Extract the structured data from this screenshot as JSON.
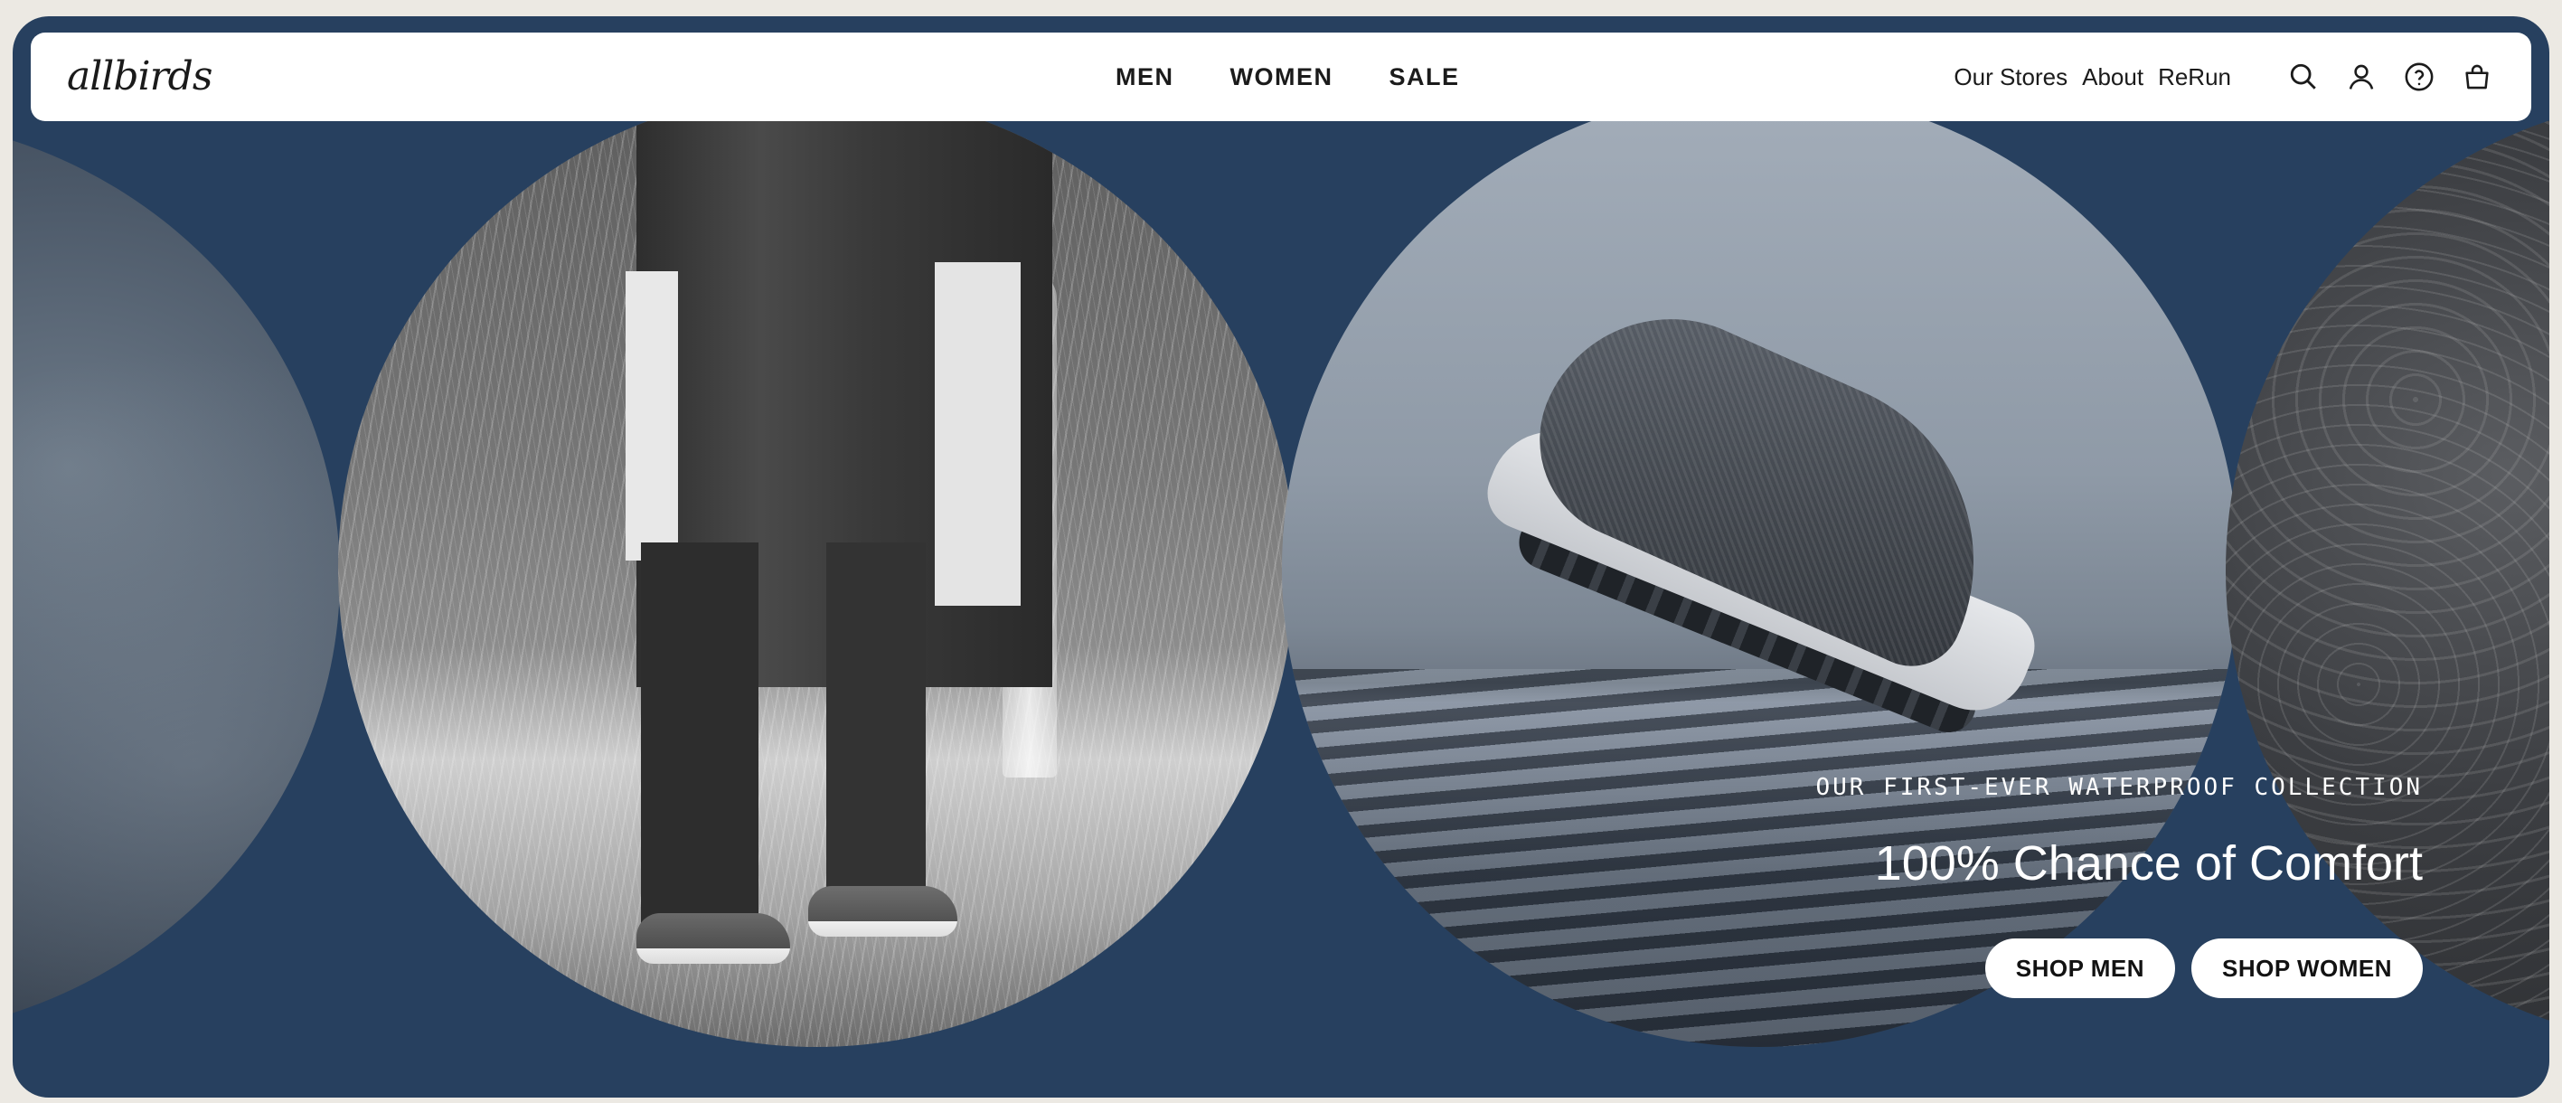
{
  "brand": {
    "logo_text": "allbirds"
  },
  "nav": {
    "primary": [
      {
        "label": "MEN"
      },
      {
        "label": "WOMEN"
      },
      {
        "label": "SALE"
      }
    ],
    "secondary": [
      {
        "label": "Our Stores"
      },
      {
        "label": "About"
      },
      {
        "label": "ReRun"
      }
    ],
    "icons": [
      "search-icon",
      "account-icon",
      "help-icon",
      "cart-icon"
    ]
  },
  "hero": {
    "eyebrow": "OUR FIRST-EVER WATERPROOF COLLECTION",
    "headline": "100% Chance of Comfort",
    "cta_men": "SHOP MEN",
    "cta_women": "SHOP WOMEN"
  },
  "colors": {
    "hero_background": "#27405f",
    "nav_background": "#ffffff",
    "page_background": "#ece9e3",
    "button_background": "#ffffff",
    "text_light": "#ffffff"
  }
}
